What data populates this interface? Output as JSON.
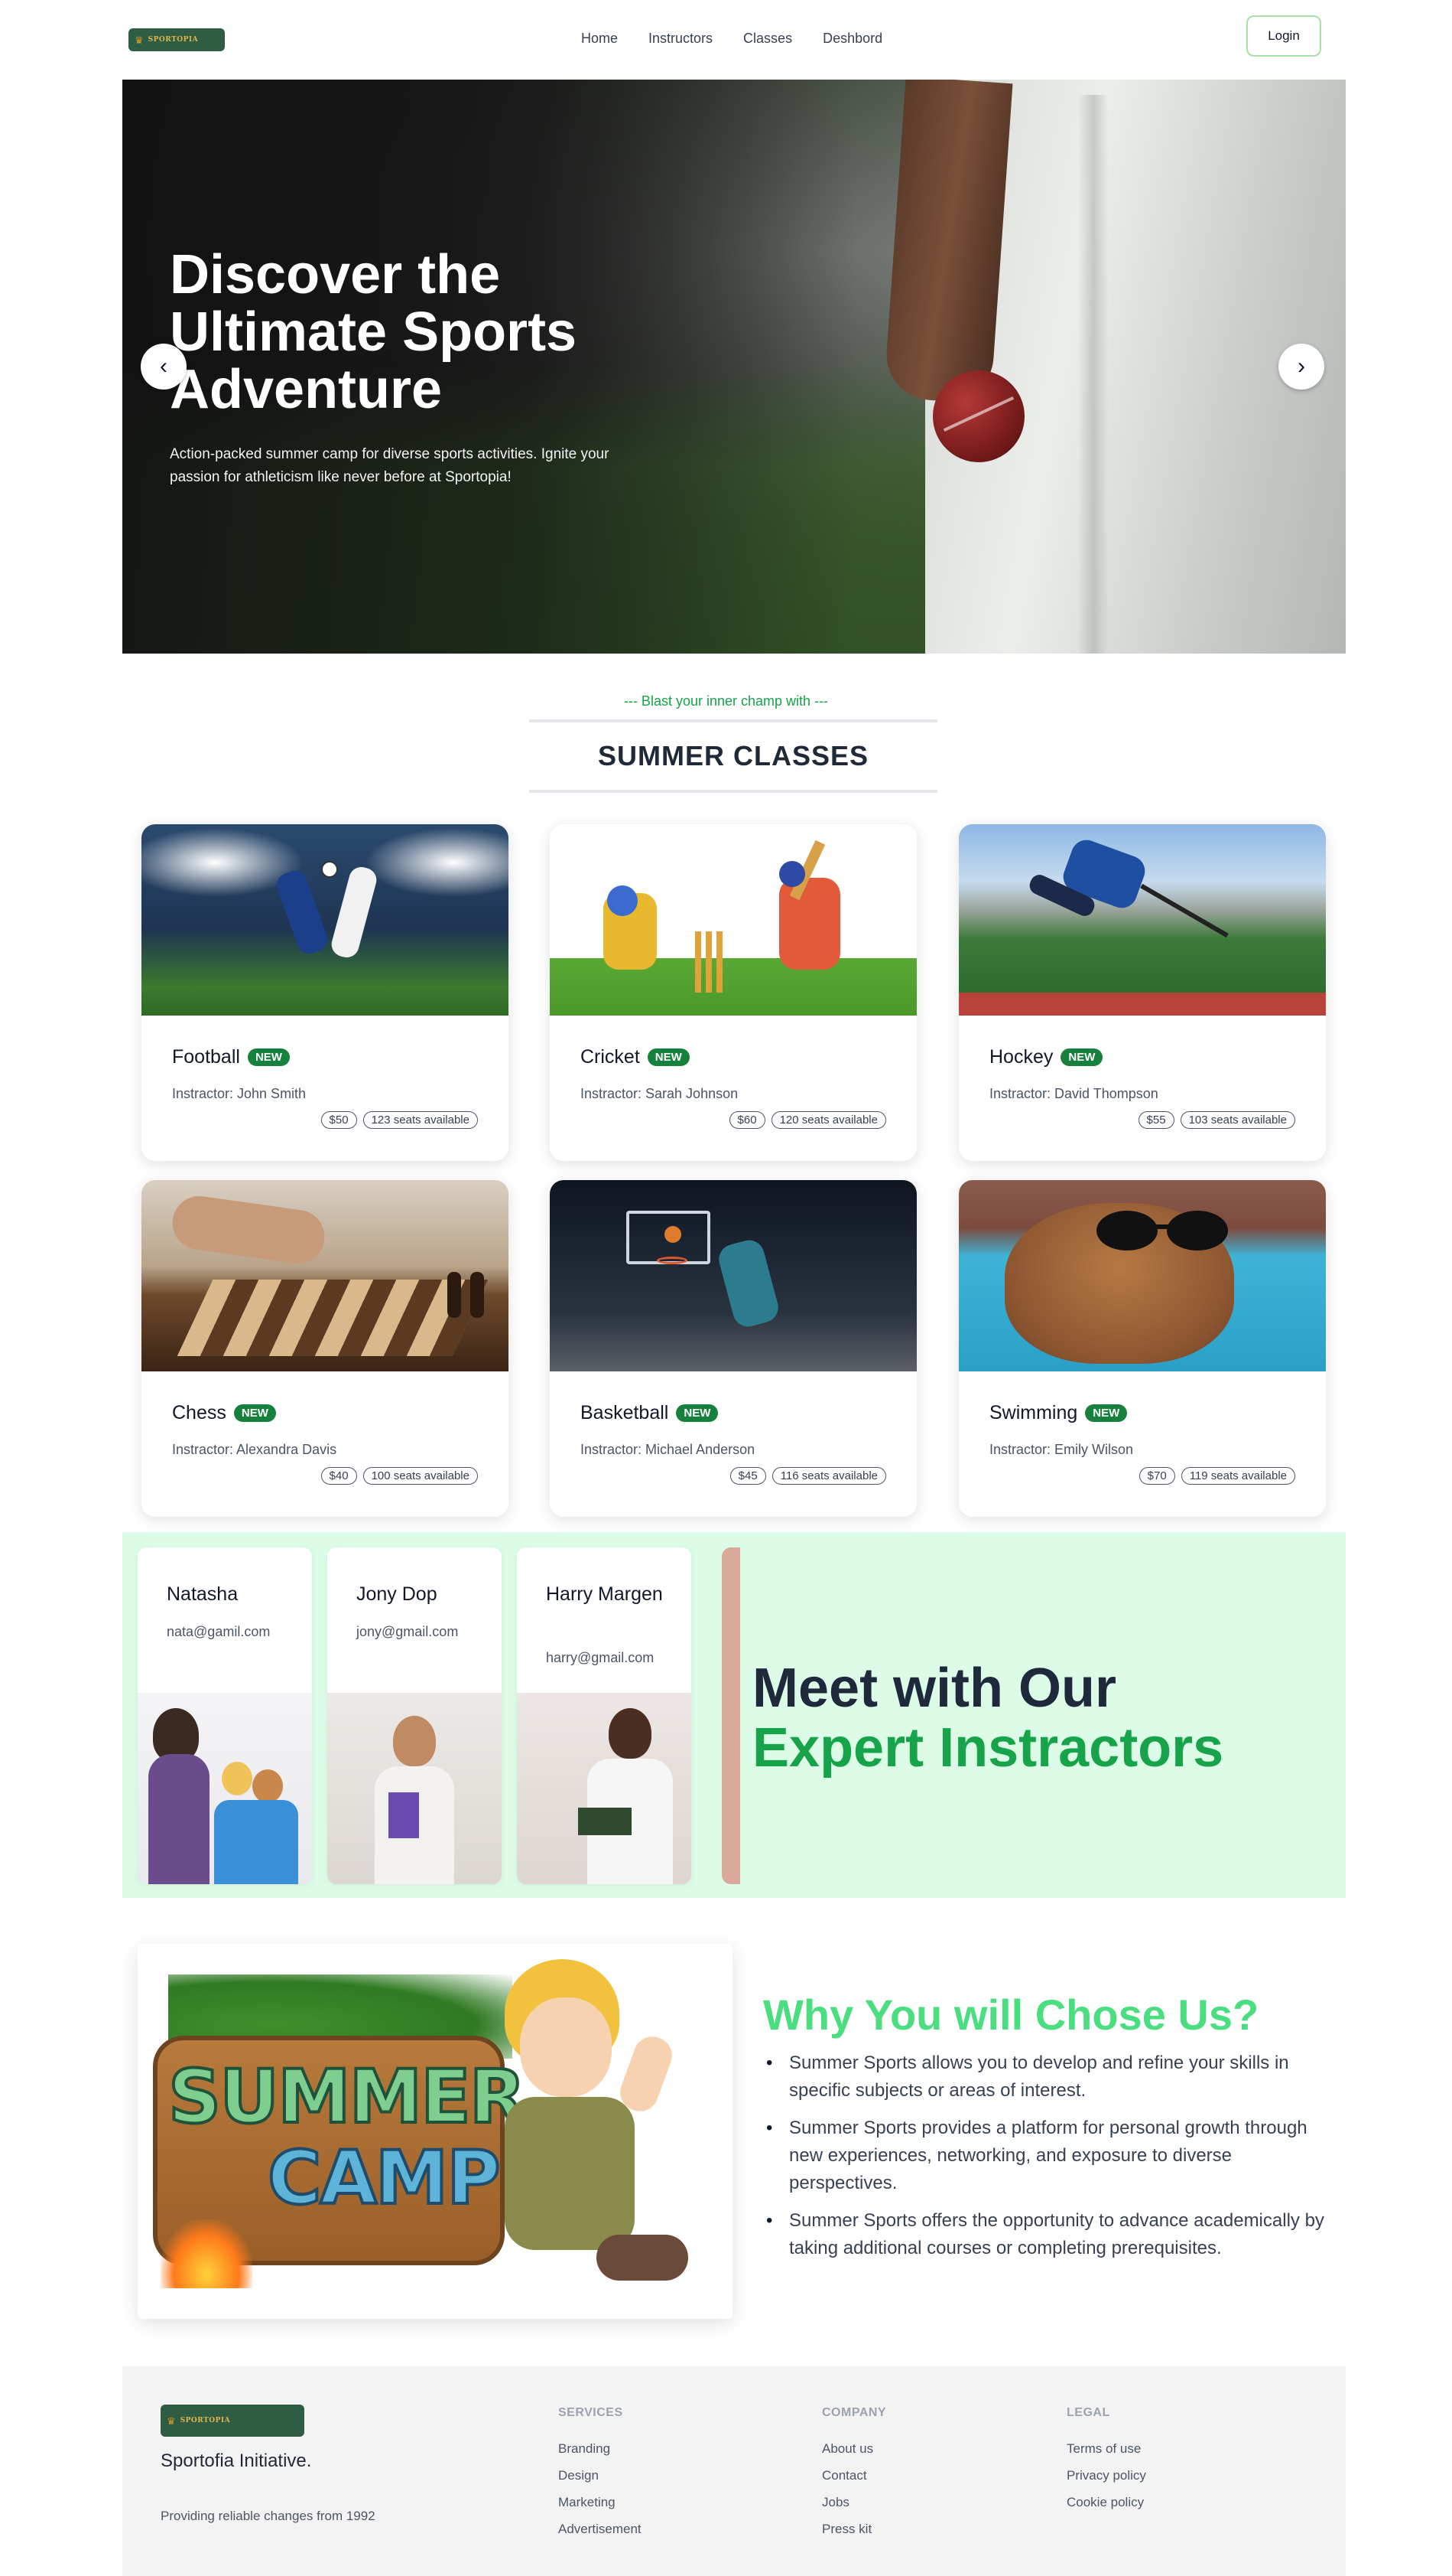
{
  "brand": {
    "logo_text": "SPORTOPIA",
    "logo_icon": "trophy-icon",
    "accent": "#16a34a",
    "dark_accent": "#2f5d43"
  },
  "nav": {
    "links": [
      "Home",
      "Instructors",
      "Classes",
      "Deshbord"
    ],
    "login_label": "Login"
  },
  "hero": {
    "title": "Discover the Ultimate Sports Adventure",
    "description": "Action-packed summer camp for diverse sports activities. Ignite your passion for athleticism like never before at Sportopia!",
    "prev_icon": "chevron-left-icon",
    "next_icon": "chevron-right-icon",
    "prev_glyph": "‹",
    "next_glyph": "›"
  },
  "classes_section": {
    "eyebrow": "--- Blast your inner champ with ---",
    "title": "SUMMER CLASSES"
  },
  "classes": [
    {
      "name": "Football",
      "badge": "NEW",
      "instructor": "Instractor: John Smith",
      "price": "$50",
      "seats": "123 seats available"
    },
    {
      "name": "Cricket",
      "badge": "NEW",
      "instructor": "Instractor: Sarah Johnson",
      "price": "$60",
      "seats": "120 seats available"
    },
    {
      "name": "Hockey",
      "badge": "NEW",
      "instructor": "Instractor: David Thompson",
      "price": "$55",
      "seats": "103 seats available"
    },
    {
      "name": "Chess",
      "badge": "NEW",
      "instructor": "Instractor: Alexandra Davis",
      "price": "$40",
      "seats": "100 seats available"
    },
    {
      "name": "Basketball",
      "badge": "NEW",
      "instructor": "Instractor: Michael Anderson",
      "price": "$45",
      "seats": "116 seats available"
    },
    {
      "name": "Swimming",
      "badge": "NEW",
      "instructor": "Instractor: Emily Wilson",
      "price": "$70",
      "seats": "119 seats available"
    }
  ],
  "instructors": {
    "title_line1": "Meet with Our",
    "title_line2": "Expert Instractors",
    "cards": [
      {
        "name": "Natasha",
        "email": "nata@gamil.com"
      },
      {
        "name": "Jony Dop",
        "email": "jony@gmail.com"
      },
      {
        "name": "Harry Margen",
        "email": "harry@gmail.com"
      }
    ]
  },
  "why": {
    "title": "Why You will Chose Us?",
    "image_text_1": "SUMMER",
    "image_text_2": "CAMP",
    "points": [
      "Summer Sports allows you to develop and refine your skills in specific subjects or areas of interest.",
      "Summer Sports provides a platform for personal growth through new experiences, networking, and exposure to diverse perspectives.",
      "Summer Sports offers the opportunity to advance academically by taking additional courses or completing prerequisites."
    ]
  },
  "footer": {
    "logo_text": "SPORTOPIA",
    "brand": "Sportofia Initiative.",
    "tagline": "Providing reliable changes from 1992",
    "columns": [
      {
        "title": "SERVICES",
        "links": [
          "Branding",
          "Design",
          "Marketing",
          "Advertisement"
        ]
      },
      {
        "title": "COMPANY",
        "links": [
          "About us",
          "Contact",
          "Jobs",
          "Press kit"
        ]
      },
      {
        "title": "LEGAL",
        "links": [
          "Terms of use",
          "Privacy policy",
          "Cookie policy"
        ]
      }
    ]
  }
}
